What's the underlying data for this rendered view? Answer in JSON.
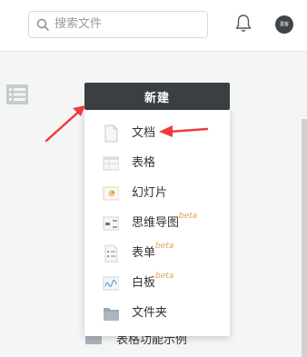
{
  "header": {
    "search_placeholder": "搜索文件",
    "avatar_text": "墨客"
  },
  "toolbar": {
    "new_label": "新建"
  },
  "menu": {
    "items": [
      {
        "label": "文档",
        "beta": "",
        "icon": "document-icon"
      },
      {
        "label": "表格",
        "beta": "",
        "icon": "spreadsheet-icon"
      },
      {
        "label": "幻灯片",
        "beta": "",
        "icon": "slides-icon"
      },
      {
        "label": "思维导图",
        "beta": "beta",
        "icon": "mindmap-icon"
      },
      {
        "label": "表单",
        "beta": "beta",
        "icon": "form-icon"
      },
      {
        "label": "白板",
        "beta": "beta",
        "icon": "whiteboard-icon"
      },
      {
        "label": "文件夹",
        "beta": "",
        "icon": "folder-icon"
      }
    ]
  },
  "background": {
    "item_label": "表格功能示例"
  },
  "colors": {
    "accent_dark": "#3a3f42",
    "annotation_red": "#f03c3c",
    "beta_orange": "#e0a25c"
  }
}
